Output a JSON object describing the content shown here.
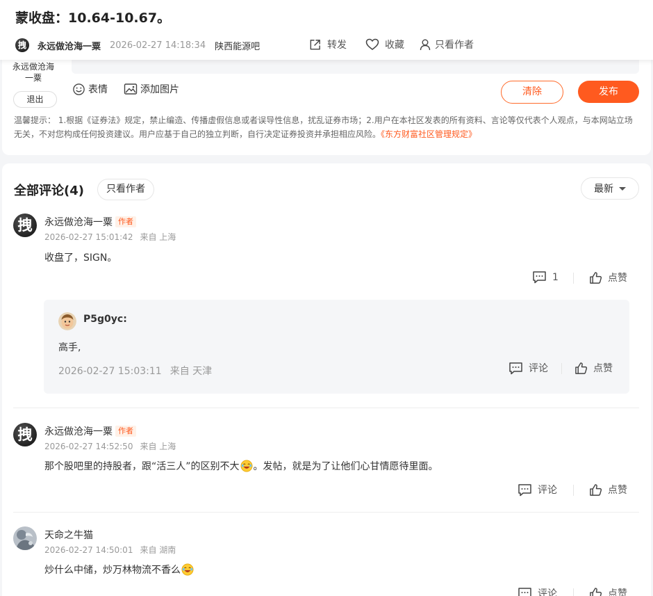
{
  "header": {
    "title": "蒙收盘：10.64-10.67。",
    "author": "永远做沧海一粟",
    "author_avatar_char": "拽",
    "time": "2026-02-27 14:18:34",
    "bar": "陕西能源吧",
    "share_label": "转发",
    "favorite_label": "收藏",
    "only_author_label": "只看作者"
  },
  "compose": {
    "username": "永远做沧海一粟",
    "logout_label": "退出",
    "emoji_label": "表情",
    "image_label": "添加图片",
    "clear_label": "清除",
    "publish_label": "发布",
    "notice_text": "温馨提示： 1.根据《证券法》规定，禁止编造、传播虚假信息或者误导性信息，扰乱证券市场；2.用户在本社区发表的所有资料、言论等仅代表个人观点，与本网站立场无关，不对您构成任何投资建议。用户应基于自己的独立判断，自行决定证券投资并承担相应风险。",
    "notice_link": "《东方财富社区管理规定》"
  },
  "comments": {
    "title": "全部评论(4)",
    "only_author_label": "只看作者",
    "sort_label": "最新",
    "author_tag": "作者",
    "comment_label": "评论",
    "like_label": "点赞",
    "items": [
      {
        "avatar_char": "拽",
        "name": "永远做沧海一粟",
        "time": "2026-02-27 15:01:42",
        "location": "来自 上海",
        "text": "收盘了，SIGN。",
        "reply_count": "1",
        "reply": {
          "name": "P5g0yc:",
          "text": "高手,",
          "time": "2026-02-27 15:03:11",
          "location": "来自 天津"
        }
      },
      {
        "avatar_char": "拽",
        "name": "永远做沧海一粟",
        "time": "2026-02-27 14:52:50",
        "location": "来自 上海",
        "text_before": "那个股吧里的持股者，跟“活三人”的区别不大",
        "text_after": "。发帖，就是为了让他们心甘情愿待里面。"
      },
      {
        "name": "天命之牛猫",
        "time": "2026-02-27 14:50:01",
        "location": "来自 湖南",
        "text_before": "炒什么中储，炒万林物流不香么"
      }
    ]
  }
}
